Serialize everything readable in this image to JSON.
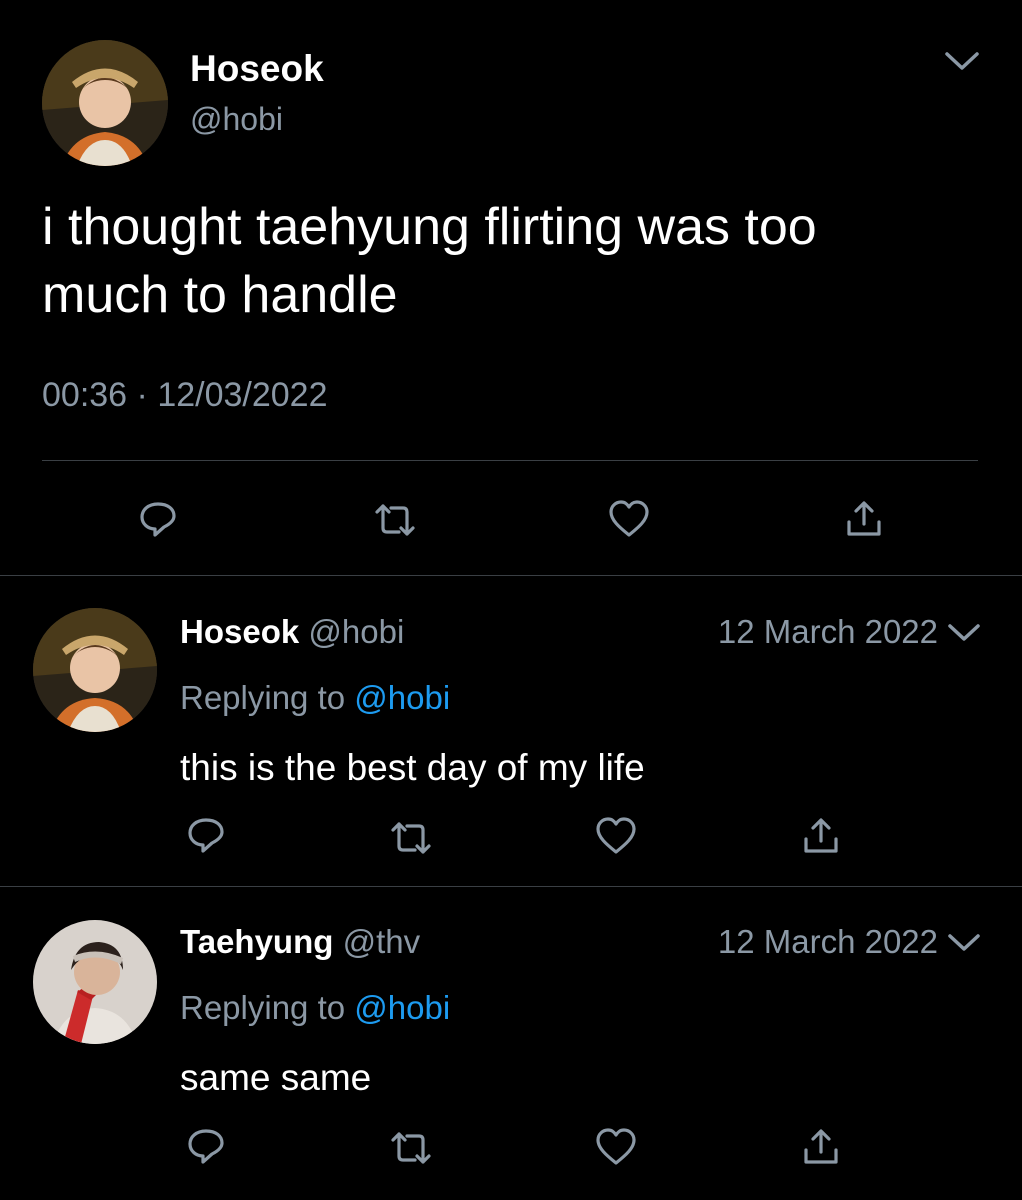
{
  "main_tweet": {
    "display_name": "Hoseok",
    "handle": "@hobi",
    "text_line1": "i thought taehyung flirting was too",
    "text_line2": "much to handle",
    "time": "00:36",
    "separator": "·",
    "date": "12/03/2022",
    "avatar_icon": "avatar-hoseok",
    "menu_icon": "chevron-down-icon"
  },
  "replies": [
    {
      "display_name": "Hoseok",
      "handle": "@hobi",
      "date": "12 March 2022",
      "replying_prefix": "Replying to",
      "replying_to": "@hobi",
      "text": "this is the best day of my life",
      "avatar_icon": "avatar-hoseok"
    },
    {
      "display_name": "Taehyung",
      "handle": "@thv",
      "date": "12 March 2022",
      "replying_prefix": "Replying to",
      "replying_to": "@hobi",
      "text": "same same",
      "avatar_icon": "avatar-taehyung"
    }
  ],
  "actions": [
    "reply-icon",
    "retweet-icon",
    "like-icon",
    "share-icon"
  ],
  "colors": {
    "background": "#000000",
    "text": "#ffffff",
    "secondary": "#8b98a5",
    "link": "#1d9bf0",
    "divider": "#3a3f44"
  }
}
